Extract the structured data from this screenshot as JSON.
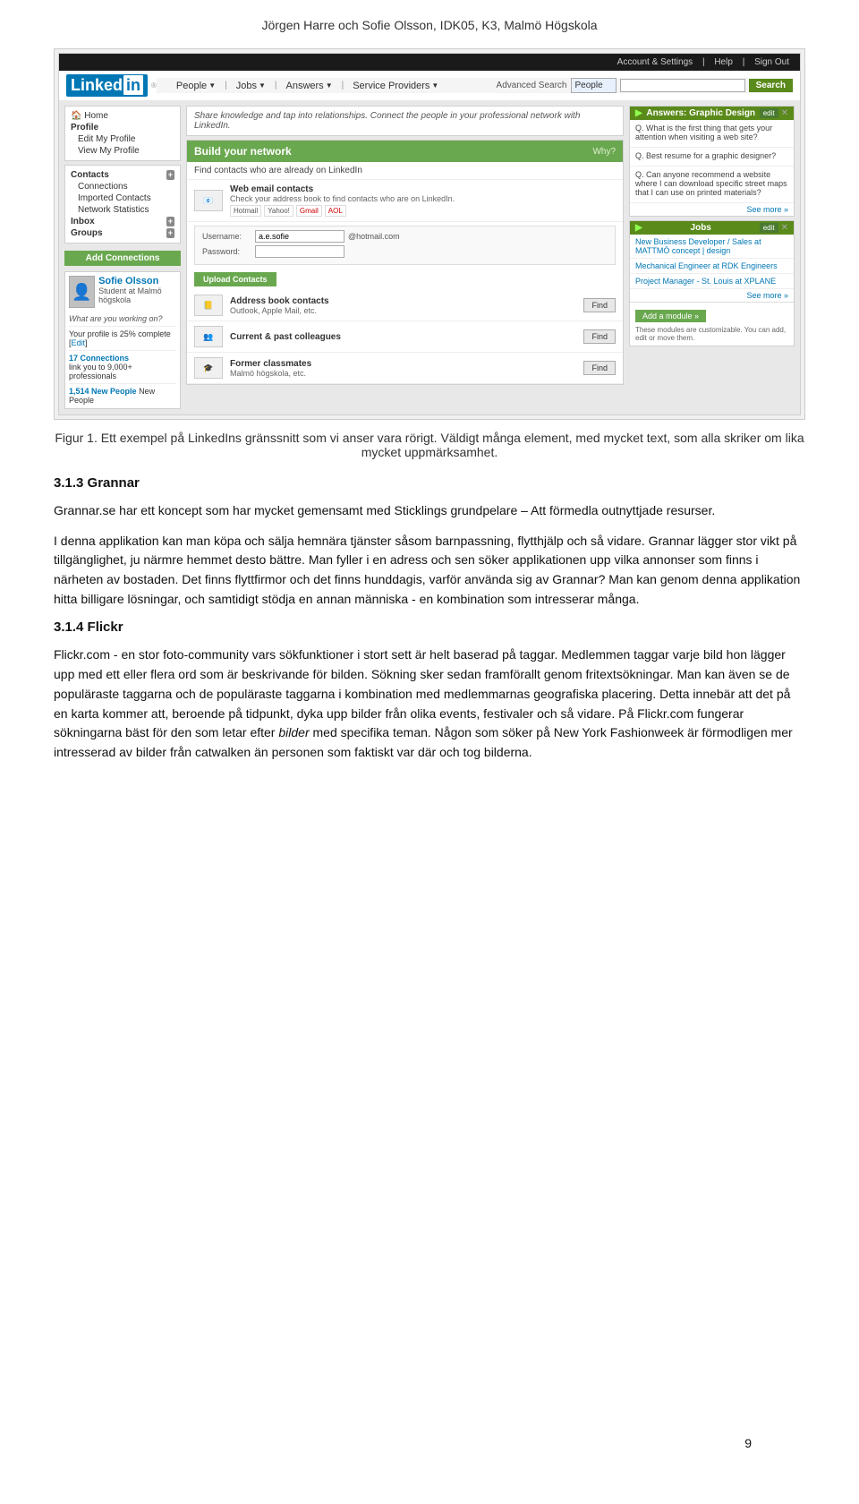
{
  "page": {
    "header": "Jörgen Harre och Sofie Olsson, IDK05, K3, Malmö Högskola",
    "page_number": "9"
  },
  "linkedin": {
    "topnav": {
      "account_settings": "Account & Settings",
      "help": "Help",
      "sign_out": "Sign Out"
    },
    "logo_text": "Linked",
    "logo_in": "in",
    "navbar": {
      "people": "People",
      "people_arrow": "▼",
      "jobs": "Jobs",
      "jobs_arrow": "▼",
      "answers": "Answers",
      "answers_arrow": "▼",
      "service_providers": "Service Providers",
      "service_providers_arrow": "▼",
      "advanced_search": "Advanced Search",
      "search_select": "People",
      "search_btn": "Search"
    },
    "sidebar": {
      "home": "Home",
      "profile": "Profile",
      "edit_my_profile": "Edit My Profile",
      "view_my_profile": "View My Profile",
      "contacts": "Contacts",
      "connections": "Connections",
      "imported_contacts": "Imported Contacts",
      "network_statistics": "Network Statistics",
      "inbox": "Inbox",
      "groups": "Groups",
      "add_connections_btn": "Add Connections",
      "profile_name": "Sofie Olsson",
      "profile_subtitle": "Student at Malmö högskola",
      "profile_question": "What are you working on?",
      "profile_completion": "Your profile is 25% complete",
      "edit_link": "Edit",
      "connections_count": "17 Connections",
      "connections_desc": "link you to 9,000+ professionals",
      "new_people_count": "1,514 New People"
    },
    "tagline": "Share knowledge and tap into relationships. Connect the people in your professional network with LinkedIn.",
    "network_box": {
      "title": "Build your network",
      "why_link": "Why?",
      "subtitle": "Find contacts who are already on LinkedIn",
      "web_email_title": "Web email contacts",
      "web_email_desc": "Check your address book to find contacts who are on LinkedIn.",
      "email_logos": [
        "Windows Live Hotmail",
        "Gmail",
        "Yahoo!",
        "AOL"
      ],
      "username_label": "Username:",
      "username_value": "a.e.sofie",
      "username_domain": "@hotmail.com",
      "password_label": "Password:",
      "upload_btn": "Upload Contacts",
      "address_book_title": "Address book contacts",
      "address_book_desc": "Outlook, Apple Mail, etc.",
      "address_book_find": "Find",
      "colleagues_title": "Current & past colleagues",
      "colleagues_find": "Find",
      "classmates_title": "Former classmates",
      "classmates_desc": "Malmö högskola, etc.",
      "classmates_find": "Find"
    },
    "right_panel": {
      "answers_header": "Answers: Graphic Design",
      "answers_questions": [
        "What is the first thing that gets your attention when visiting a web site?",
        "Best resume for a graphic designer?",
        "Can anyone recommend a website where I can download specific street maps that I can use on printed materials?"
      ],
      "answers_see_more": "See more »",
      "jobs_header": "Jobs",
      "jobs_list": [
        "New Business Developer / Sales at MATTMÖ concept | design",
        "Mechanical Engineer at RDK Engineers",
        "Project Manager - St. Louis at XPLANE"
      ],
      "jobs_see_more": "See more »",
      "add_module_btn": "Add a module »",
      "customize_note": "These modules are customizable. You can add, edit or move them."
    }
  },
  "figure_caption": {
    "text": "Figur 1. Ett exempel på LinkedIns gränssnitt som vi anser vara rörigt. Väldigt många element, med mycket text, som alla skriker om lika mycket uppmärksamhet."
  },
  "sections": [
    {
      "heading": "3.1.3 Grannar",
      "paragraphs": [
        "Grannar.se har ett koncept som har mycket gemensamt med Sticklings grundpelare – Att förmedla outnyttjade resurser.",
        "I denna applikation kan man köpa och sälja hemnära tjänster såsom barnpassning, flytthjälp och så vidare. Grannar lägger stor vikt på tillgänglighet, ju närmre hemmet desto bättre. Man fyller i en adress och sen söker applikationen upp vilka annonser som finns i närheten av bostaden. Det finns flyttfirmor och det finns hunddagis, varför använda sig av Grannar? Man kan genom denna applikation hitta billigare lösningar, och samtidigt stödja en annan människa - en kombination som intresserar många."
      ]
    },
    {
      "heading": "3.1.4 Flickr",
      "paragraphs": [
        "Flickr.com - en stor foto-community vars sökfunktioner i stort sett är helt baserad på taggar. Medlemmen taggar varje bild hon lägger upp med ett eller flera ord som är beskrivande för bilden. Sökning sker sedan framförallt genom fritextsökningar. Man kan även se de populäraste taggarna och de populäraste taggarna i kombination med medlemmarnas geografiska placering. Detta innebär att det på en karta kommer att, beroende på tidpunkt, dyka upp bilder från olika events, festivaler och så vidare. På Flickr.com fungerar sökningarna bäst för den som letar efter bilder med specifika teman. Någon som söker på New York Fashionweek är förmodligen mer intresserad av bilder från catwalken än personen som faktiskt var där och tog bilderna."
      ]
    }
  ]
}
